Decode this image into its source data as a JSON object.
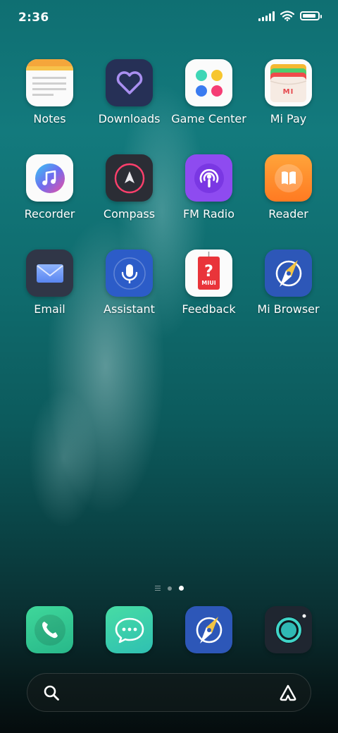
{
  "status": {
    "time": "2:36",
    "battery_level": 0.9
  },
  "apps": [
    {
      "name": "Notes",
      "icon": "notes-icon"
    },
    {
      "name": "Downloads",
      "icon": "downloads-icon"
    },
    {
      "name": "Game Center",
      "icon": "game-center-icon"
    },
    {
      "name": "Mi Pay",
      "icon": "mi-pay-icon"
    },
    {
      "name": "Recorder",
      "icon": "recorder-icon"
    },
    {
      "name": "Compass",
      "icon": "compass-icon"
    },
    {
      "name": "FM Radio",
      "icon": "fm-radio-icon"
    },
    {
      "name": "Reader",
      "icon": "reader-icon"
    },
    {
      "name": "Email",
      "icon": "email-icon"
    },
    {
      "name": "Assistant",
      "icon": "assistant-icon"
    },
    {
      "name": "Feedback",
      "icon": "feedback-icon"
    },
    {
      "name": "Mi Browser",
      "icon": "mi-browser-icon"
    }
  ],
  "feedback_badge": "MIUI",
  "mi_pay_logo": "MI",
  "page_indicator": {
    "pages": 2,
    "current": 2
  },
  "dock": [
    {
      "icon": "phone-icon"
    },
    {
      "icon": "messages-icon"
    },
    {
      "icon": "browser-icon"
    },
    {
      "icon": "camera-icon"
    }
  ],
  "colors": {
    "notes_top": "#f5a63b",
    "downloads_bg": "#263056",
    "downloads_heart": "#a98ff0",
    "compass_bg": "#2b2d35",
    "compass_ring": "#ff3f6c",
    "radio_bg": "#8e4bf0",
    "reader_bg": "#ff8c2e",
    "email_bg": "#303647",
    "assistant_bg": "#2c5cc8",
    "feedback_red": "#e9343a",
    "browser_bg": "#2d57b8",
    "phone_bg": "#33c98a",
    "messages_bg": "#3ad1a0",
    "camera_bg": "#1f2630",
    "camera_ring": "#40d5c8"
  }
}
